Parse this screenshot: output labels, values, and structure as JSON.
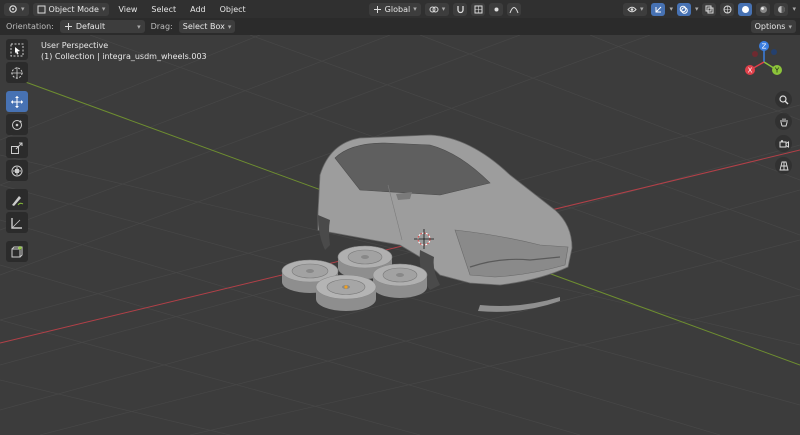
{
  "header": {
    "editor_type_icon": "view3d-icon",
    "mode": "Object Mode",
    "menus": [
      "View",
      "Select",
      "Add",
      "Object"
    ],
    "transform_orientation": "Global",
    "icons": [
      "pivot-icon",
      "snap-icon",
      "magnet-icon",
      "proportional-edit-icon",
      "falloff-icon",
      "visibility-icon",
      "gizmo-icon",
      "overlay-icon",
      "xray-icon",
      "shading-wireframe-icon",
      "shading-solid-icon",
      "shading-material-icon",
      "shading-rendered-icon"
    ]
  },
  "tool_header": {
    "orientation_label": "Orientation:",
    "orientation_value": "Default",
    "drag_label": "Drag:",
    "drag_value": "Select Box",
    "options_label": "Options"
  },
  "viewport": {
    "view_name": "User Perspective",
    "collection_info": "(1) Collection | integra_usdm_wheels.003"
  },
  "toolbar": {
    "tools": [
      "select-box",
      "cursor",
      "move",
      "rotate",
      "scale",
      "transform",
      "annotate",
      "measure",
      "add-cube"
    ],
    "active_tool": "move"
  },
  "gizmo": {
    "axes": [
      "X",
      "Y",
      "Z"
    ],
    "colors": {
      "x": "#e0404a",
      "y": "#8cc43a",
      "z": "#3b7ee0"
    }
  },
  "nav_buttons": [
    "zoom-icon",
    "pan-hand-icon",
    "camera-icon",
    "grid-perspective-icon"
  ],
  "colors": {
    "accent": "#4772b3",
    "viewport_bg": "#3c3c3c",
    "header_bg": "#303030",
    "x_axis_line": "#b24048",
    "y_axis_line": "#6e8e30"
  }
}
